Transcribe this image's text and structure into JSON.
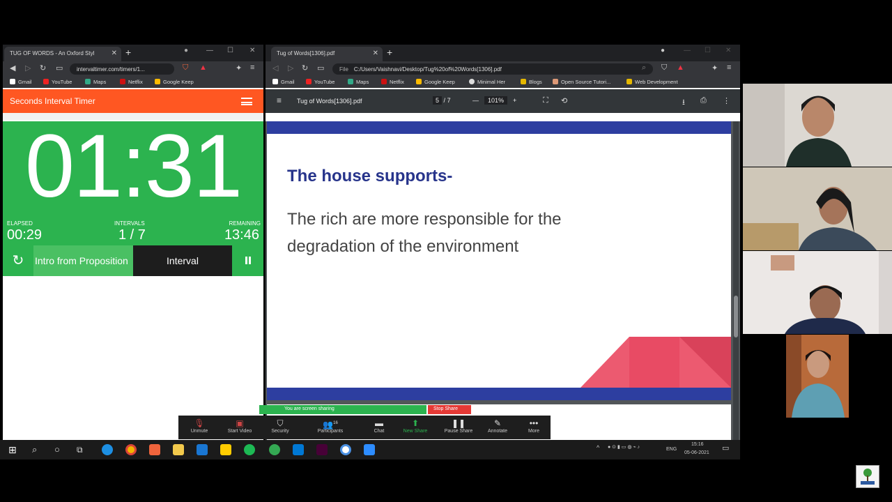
{
  "left_browser": {
    "tab_title": "TUG OF WORDS - An Oxford Styl",
    "url": "intervaltimer.com/timers/1...",
    "bookmarks": [
      "Gmail",
      "YouTube",
      "Maps",
      "Netflix",
      "Google Keep"
    ]
  },
  "timer": {
    "app_title": "Seconds Interval Timer",
    "time": "01:31",
    "elapsed_label": "ELAPSED",
    "elapsed_value": "00:29",
    "intervals_label": "INTERVALS",
    "intervals_value": "1 / 7",
    "remaining_label": "REMAINING",
    "remaining_value": "13:46",
    "phase_current": "Intro from Proposition",
    "phase_next": "Interval"
  },
  "right_browser": {
    "tab_title": "Tug of Words[1306].pdf",
    "url_prefix": "File",
    "url": "C:/Users/Vaishnavi/Desktop/Tug%20of%20Words[1306].pdf",
    "bookmarks": [
      "Gmail",
      "YouTube",
      "Maps",
      "Netflix",
      "Google Keep",
      "Minimal Her",
      "Blogs",
      "Open Source Tutori...",
      "Web Development"
    ]
  },
  "pdf": {
    "file_name": "Tug of Words[1306].pdf",
    "page_current": "5",
    "page_sep": "/",
    "page_total": "7",
    "zoom": "101%",
    "slide_heading": "The house supports-",
    "slide_body": "The rich are more responsible for the degradation of the environment"
  },
  "zoom_meeting": {
    "sharing_text": "You are screen sharing",
    "stop_share_label": "Stop Share",
    "toolbar": [
      {
        "label": "Unmute",
        "icon": "microphone-muted-icon"
      },
      {
        "label": "Start Video",
        "icon": "video-off-icon"
      },
      {
        "label": "Security",
        "icon": "shield-icon"
      },
      {
        "label": "Participants",
        "icon": "participants-icon",
        "count": "16"
      },
      {
        "label": "Chat",
        "icon": "chat-icon"
      },
      {
        "label": "New Share",
        "icon": "share-icon"
      },
      {
        "label": "Pause Share",
        "icon": "pause-icon"
      },
      {
        "label": "Annotate",
        "icon": "pen-icon"
      },
      {
        "label": "More",
        "icon": "more-icon"
      }
    ]
  },
  "taskbar": {
    "language": "ENG",
    "time": "15:16",
    "date": "05-06-2021"
  },
  "colors": {
    "timer_green": "#2cb34f",
    "timer_orange": "#ff5722",
    "slide_blue": "#2d3ea0",
    "slide_pink": "#e84b64"
  }
}
